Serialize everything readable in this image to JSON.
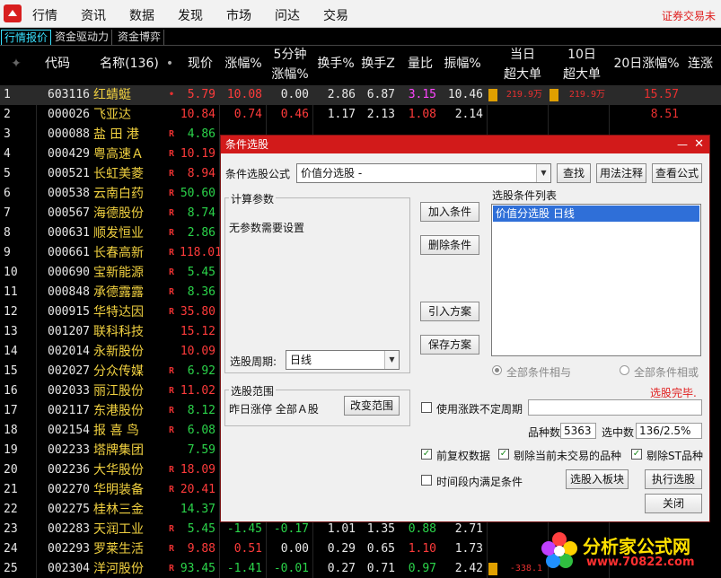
{
  "menu": [
    "行情",
    "资讯",
    "数据",
    "发现",
    "市场",
    "问达",
    "交易"
  ],
  "brand_right": "证券交易未",
  "tabs": [
    "行情报价",
    "资金驱动力",
    "资金博弈"
  ],
  "header": {
    "code": "代码",
    "name": "名称(136)",
    "price": "现价",
    "chg": "涨幅%",
    "min5_a": "5分钟",
    "min5_b": "涨幅%",
    "turn": "换手%",
    "turnz": "换手Z",
    "volr": "量比",
    "amp": "振幅%",
    "big1_a": "当日",
    "big1_b": "超大单",
    "big2_a": "10日",
    "big2_b": "超大单",
    "chg20": "20日涨幅%",
    "cont": "连涨"
  },
  "rows": [
    {
      "idx": "1",
      "code": "603116",
      "name": "红蜻蜓",
      "mark": "•",
      "price": "5.79",
      "chg": "10.08",
      "m5": "0.00",
      "turn": "2.86",
      "turnz": "6.87",
      "volr": "3.15",
      "amp": "10.46",
      "big1": "219.9万",
      "big2": "219.9万",
      "chg20": "15.57"
    },
    {
      "idx": "2",
      "code": "000026",
      "name": "飞亚达",
      "mark": "",
      "price": "10.84",
      "chg": "0.74",
      "m5": "0.46",
      "turn": "1.17",
      "turnz": "2.13",
      "volr": "1.08",
      "amp": "2.14",
      "big1": "",
      "big2": "",
      "chg20": "8.51"
    },
    {
      "idx": "3",
      "code": "000088",
      "name": "盐 田 港",
      "mark": "R",
      "price": "4.86",
      "chg": "",
      "m5": "",
      "turn": "",
      "turnz": "",
      "volr": "",
      "amp": "",
      "big1": "",
      "big2": "",
      "chg20": ""
    },
    {
      "idx": "4",
      "code": "000429",
      "name": "粤高速Ａ",
      "mark": "R",
      "price": "10.19",
      "chg": "",
      "m5": "",
      "turn": "",
      "turnz": "",
      "volr": "",
      "amp": "",
      "big1": "",
      "big2": "",
      "chg20": ""
    },
    {
      "idx": "5",
      "code": "000521",
      "name": "长虹美菱",
      "mark": "R",
      "price": "8.94",
      "chg": "",
      "m5": "",
      "turn": "",
      "turnz": "",
      "volr": "",
      "amp": "",
      "big1": "",
      "big2": "",
      "chg20": ""
    },
    {
      "idx": "6",
      "code": "000538",
      "name": "云南白药",
      "mark": "R",
      "price": "50.60",
      "chg": "",
      "m5": "",
      "turn": "",
      "turnz": "",
      "volr": "",
      "amp": "",
      "big1": "",
      "big2": "",
      "chg20": ""
    },
    {
      "idx": "7",
      "code": "000567",
      "name": "海德股份",
      "mark": "R",
      "price": "8.74",
      "chg": "",
      "m5": "",
      "turn": "",
      "turnz": "",
      "volr": "",
      "amp": "",
      "big1": "",
      "big2": "",
      "chg20": ""
    },
    {
      "idx": "8",
      "code": "000631",
      "name": "顺发恒业",
      "mark": "R",
      "price": "2.86",
      "chg": "",
      "m5": "",
      "turn": "",
      "turnz": "",
      "volr": "",
      "amp": "",
      "big1": "",
      "big2": "",
      "chg20": ""
    },
    {
      "idx": "9",
      "code": "000661",
      "name": "长春高新",
      "mark": "R",
      "price": "118.01",
      "chg": "",
      "m5": "",
      "turn": "",
      "turnz": "",
      "volr": "",
      "amp": "",
      "big1": "",
      "big2": "",
      "chg20": ""
    },
    {
      "idx": "10",
      "code": "000690",
      "name": "宝新能源",
      "mark": "R",
      "price": "5.45",
      "chg": "",
      "m5": "",
      "turn": "",
      "turnz": "",
      "volr": "",
      "amp": "",
      "big1": "",
      "big2": "",
      "chg20": ""
    },
    {
      "idx": "11",
      "code": "000848",
      "name": "承德露露",
      "mark": "R",
      "price": "8.36",
      "chg": "",
      "m5": "",
      "turn": "",
      "turnz": "",
      "volr": "",
      "amp": "",
      "big1": "",
      "big2": "",
      "chg20": ""
    },
    {
      "idx": "12",
      "code": "000915",
      "name": "华特达因",
      "mark": "R",
      "price": "35.80",
      "chg": "",
      "m5": "",
      "turn": "",
      "turnz": "",
      "volr": "",
      "amp": "",
      "big1": "",
      "big2": "",
      "chg20": ""
    },
    {
      "idx": "13",
      "code": "001207",
      "name": "联科科技",
      "mark": "",
      "price": "15.12",
      "chg": "",
      "m5": "",
      "turn": "",
      "turnz": "",
      "volr": "",
      "amp": "",
      "big1": "",
      "big2": "",
      "chg20": ""
    },
    {
      "idx": "14",
      "code": "002014",
      "name": "永新股份",
      "mark": "",
      "price": "10.09",
      "chg": "",
      "m5": "",
      "turn": "",
      "turnz": "",
      "volr": "",
      "amp": "",
      "big1": "",
      "big2": "",
      "chg20": ""
    },
    {
      "idx": "15",
      "code": "002027",
      "name": "分众传媒",
      "mark": "R",
      "price": "6.92",
      "chg": "",
      "m5": "",
      "turn": "",
      "turnz": "",
      "volr": "",
      "amp": "",
      "big1": "",
      "big2": "",
      "chg20": ""
    },
    {
      "idx": "16",
      "code": "002033",
      "name": "丽江股份",
      "mark": "R",
      "price": "11.02",
      "chg": "",
      "m5": "",
      "turn": "",
      "turnz": "",
      "volr": "",
      "amp": "",
      "big1": "",
      "big2": "",
      "chg20": ""
    },
    {
      "idx": "17",
      "code": "002117",
      "name": "东港股份",
      "mark": "R",
      "price": "8.12",
      "chg": "",
      "m5": "",
      "turn": "",
      "turnz": "",
      "volr": "",
      "amp": "",
      "big1": "",
      "big2": "",
      "chg20": ""
    },
    {
      "idx": "18",
      "code": "002154",
      "name": "报 喜 鸟",
      "mark": "R",
      "price": "6.08",
      "chg": "",
      "m5": "",
      "turn": "",
      "turnz": "",
      "volr": "",
      "amp": "",
      "big1": "",
      "big2": "",
      "chg20": ""
    },
    {
      "idx": "19",
      "code": "002233",
      "name": "塔牌集团",
      "mark": "",
      "price": "7.59",
      "chg": "",
      "m5": "",
      "turn": "",
      "turnz": "",
      "volr": "",
      "amp": "",
      "big1": "",
      "big2": "",
      "chg20": ""
    },
    {
      "idx": "20",
      "code": "002236",
      "name": "大华股份",
      "mark": "R",
      "price": "18.09",
      "chg": "",
      "m5": "",
      "turn": "",
      "turnz": "",
      "volr": "",
      "amp": "",
      "big1": "",
      "big2": "",
      "chg20": ""
    },
    {
      "idx": "21",
      "code": "002270",
      "name": "华明装备",
      "mark": "R",
      "price": "20.41",
      "chg": "",
      "m5": "",
      "turn": "",
      "turnz": "",
      "volr": "",
      "amp": "",
      "big1": "",
      "big2": "",
      "chg20": ""
    },
    {
      "idx": "22",
      "code": "002275",
      "name": "桂林三金",
      "mark": "",
      "price": "14.37",
      "chg": "",
      "m5": "",
      "turn": "",
      "turnz": "",
      "volr": "",
      "amp": "",
      "big1": "",
      "big2": "",
      "chg20": ""
    },
    {
      "idx": "23",
      "code": "002283",
      "name": "天润工业",
      "mark": "R",
      "price": "5.45",
      "chg": "-1.45",
      "m5": "-0.17",
      "turn": "1.01",
      "turnz": "1.35",
      "volr": "0.88",
      "amp": "2.71",
      "big1": "",
      "big2": "",
      "chg20": ""
    },
    {
      "idx": "24",
      "code": "002293",
      "name": "罗莱生活",
      "mark": "R",
      "price": "9.88",
      "chg": "0.51",
      "m5": "0.00",
      "turn": "0.29",
      "turnz": "0.65",
      "volr": "1.10",
      "amp": "1.73",
      "big1": "",
      "big2": "",
      "chg20": ""
    },
    {
      "idx": "25",
      "code": "002304",
      "name": "洋河股份",
      "mark": "R",
      "price": "93.45",
      "chg": "-1.41",
      "m5": "-0.01",
      "turn": "0.27",
      "turnz": "0.71",
      "volr": "0.97",
      "amp": "2.42",
      "big1": "-338.1",
      "big2": "",
      "chg20": ""
    }
  ],
  "row_colors": {
    "price": [
      "red",
      "red",
      "green",
      "red",
      "red",
      "green",
      "green",
      "green",
      "red",
      "green",
      "green",
      "red",
      "red",
      "red",
      "green",
      "red",
      "green",
      "green",
      "green",
      "red",
      "red",
      "green",
      "green",
      "red",
      "green"
    ],
    "chg": [
      "red",
      "red",
      "",
      "",
      "",
      "",
      "",
      "",
      "",
      "",
      "",
      "",
      "",
      "",
      "",
      "",
      "",
      "",
      "",
      "",
      "",
      "",
      "green",
      "red",
      "green"
    ],
    "m5": [
      "white",
      "red",
      "",
      "",
      "",
      "",
      "",
      "",
      "",
      "",
      "",
      "",
      "",
      "",
      "",
      "",
      "",
      "",
      "",
      "",
      "",
      "",
      "green",
      "white",
      "green"
    ],
    "volr": [
      "magenta",
      "red",
      "",
      "",
      "",
      "",
      "",
      "",
      "",
      "",
      "",
      "",
      "",
      "",
      "",
      "",
      "",
      "",
      "",
      "",
      "",
      "",
      "green",
      "red",
      "green"
    ]
  },
  "dialog": {
    "title": "条件选股",
    "formula_label": "条件选股公式",
    "formula_value": "价值分选股   -",
    "btn_find": "查找",
    "btn_usage": "用法注释",
    "btn_view": "查看公式",
    "calc_params": "计算参数",
    "no_params": "无参数需要设置",
    "cond_list_label": "选股条件列表",
    "cond_item": "价值分选股  日线",
    "btn_add": "加入条件",
    "btn_delete": "删除条件",
    "btn_import": "引入方案",
    "btn_save": "保存方案",
    "period_label": "选股周期:",
    "period_value": "日线",
    "radio_and": "全部条件相与",
    "radio_or": "全部条件相或",
    "status": "选股完毕.",
    "range_title": "选股范围",
    "range_value": "昨日涨停 全部Ａ股",
    "btn_change_range": "改变范围",
    "use_uncertain_period": "使用涨跌不定周期",
    "species_label": "品种数",
    "species_value": "5363",
    "selected_label": "选中数",
    "selected_value": "136/2.5%",
    "chk_fq": "前复权数据",
    "chk_remove_untraded": "剔除当前未交易的品种",
    "chk_remove_st": "剔除ST品种",
    "chk_time_period": "时间段内满足条件",
    "btn_to_block": "选股入板块",
    "btn_run": "执行选股",
    "btn_close": "关闭"
  },
  "watermark": {
    "line1": "分析家公式网",
    "line2": "www.70822.com"
  },
  "colors": {
    "dialog_title": "#d21a1a",
    "list_select": "#2f6fd8",
    "status_red": "#e02020"
  }
}
